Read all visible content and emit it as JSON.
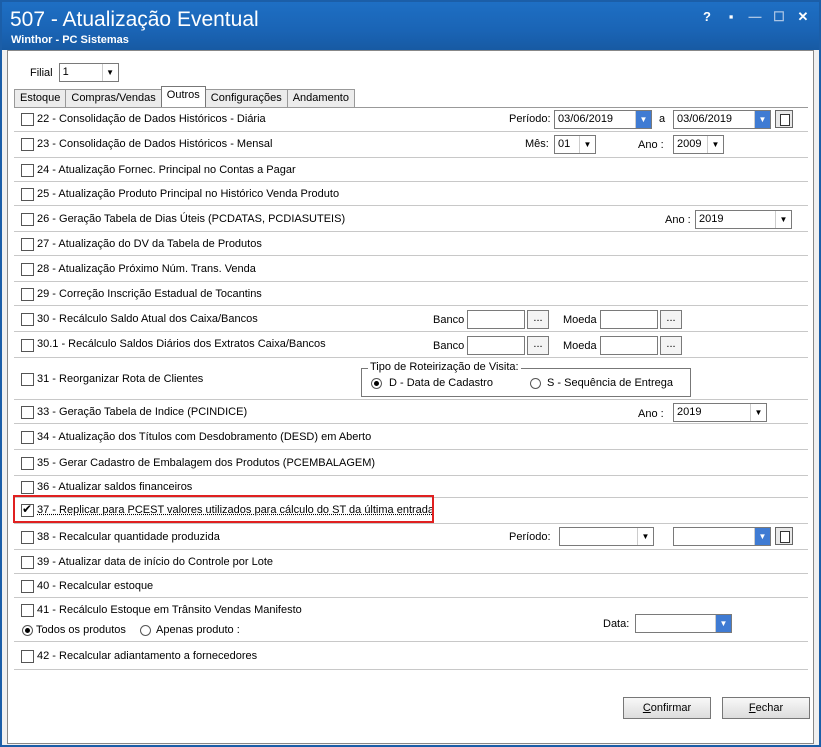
{
  "window": {
    "title": "507 - Atualização Eventual",
    "subtitle": "Winthor - PC Sistemas",
    "help": "?",
    "restore": "▪",
    "minimize": "—",
    "maximize": "☐",
    "close": "✕"
  },
  "filial": {
    "label": "Filial",
    "value": "1"
  },
  "tabs": [
    {
      "label": "Estoque"
    },
    {
      "label": "Compras/Vendas"
    },
    {
      "label": "Outros"
    },
    {
      "label": "Configurações"
    },
    {
      "label": "Andamento"
    }
  ],
  "rows": {
    "r22": {
      "label": "22 - Consolidação de Dados Históricos - Diária",
      "periodo_label": "Período:",
      "date_from": "03/06/2019",
      "a_label": "a",
      "date_to": "03/06/2019"
    },
    "r23": {
      "label": "23 - Consolidação de Dados Históricos - Mensal",
      "mes_label": "Mês:",
      "mes": "01",
      "ano_label": "Ano :",
      "ano": "2009"
    },
    "r24": {
      "label": "24 - Atualização Fornec. Principal no Contas a Pagar"
    },
    "r25": {
      "label": "25 - Atualização Produto Principal no Histórico Venda Produto"
    },
    "r26": {
      "label": "26 - Geração Tabela de Dias Úteis (PCDATAS, PCDIASUTEIS)",
      "ano_label": "Ano :",
      "ano": "2019"
    },
    "r27": {
      "label": "27 - Atualização do DV da Tabela de Produtos"
    },
    "r28": {
      "label": "28 - Atualização Próximo Núm. Trans. Venda"
    },
    "r29": {
      "label": "29 - Correção Inscrição Estadual de Tocantins"
    },
    "r30": {
      "label": "30 - Recálculo Saldo Atual dos Caixa/Bancos",
      "banco_label": "Banco",
      "moeda_label": "Moeda",
      "dots": "..."
    },
    "r301": {
      "label": "30.1 - Recálculo Saldos Diários dos Extratos Caixa/Bancos",
      "banco_label": "Banco",
      "moeda_label": "Moeda",
      "dots": "..."
    },
    "r31": {
      "label": "31 - Reorganizar Rota de Clientes",
      "group_title": "Tipo de Roteirização de Visita:",
      "opt_d": "D - Data de Cadastro",
      "opt_s": "S - Sequência de Entrega"
    },
    "r33": {
      "label": "33 - Geração Tabela de Indice (PCINDICE)",
      "ano_label": "Ano :",
      "ano": "2019"
    },
    "r34": {
      "label": "34 - Atualização dos Títulos com Desdobramento (DESD) em Aberto"
    },
    "r35": {
      "label": "35 - Gerar Cadastro de Embalagem dos Produtos (PCEMBALAGEM)"
    },
    "r36": {
      "label": "36 - Atualizar saldos financeiros"
    },
    "r37": {
      "label": "37 - Replicar para PCEST valores utilizados para cálculo do ST da última entrada",
      "checked": true
    },
    "r38": {
      "label": "38 - Recalcular quantidade produzida",
      "periodo_label": "Período:"
    },
    "r39": {
      "label": "39 - Atualizar data de início do Controle por Lote"
    },
    "r40": {
      "label": "40 - Recalcular estoque"
    },
    "r41": {
      "label": "41 - Recálculo Estoque em Trânsito Vendas Manifesto",
      "opt_todos": "Todos os produtos",
      "opt_apenas": "Apenas produto :",
      "data_label": "Data:"
    },
    "r42": {
      "label": "42 - Recalcular adiantamento a fornecedores"
    }
  },
  "buttons": {
    "confirm_c": "C",
    "confirm_rest": "onfirmar",
    "close_f": "F",
    "close_rest": "echar"
  },
  "colors": {
    "titlebar": "#1a64b5",
    "highlight": "#e02020"
  }
}
